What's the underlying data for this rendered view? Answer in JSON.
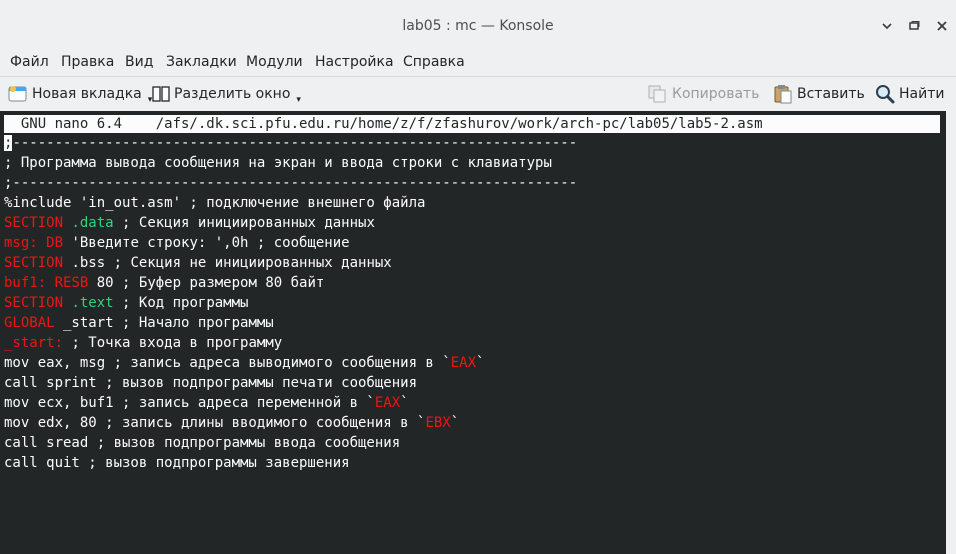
{
  "window": {
    "title": "lab05 : mc — Konsole",
    "minimize_icon": "chevron-down-icon",
    "maximize_icon": "restore-icon",
    "close_icon": "close-icon"
  },
  "menu": [
    "Файл",
    "Правка",
    "Вид",
    "Закладки",
    "Модули",
    "Настройка",
    "Справка"
  ],
  "toolbar": {
    "new_tab": "Новая вкладка",
    "split": "Разделить окно",
    "copy": "Копировать",
    "paste": "Вставить",
    "find": "Найти"
  },
  "nano": {
    "header": "  GNU nano 6.4    /afs/.dk.sci.pfu.edu.ru/home/z/f/zfashurov/work/arch-pc/lab05/lab5-2.asm"
  },
  "colors": {
    "keyword": "#ed1515",
    "section_name": "#2bd57c",
    "text": "#fcfcfc",
    "background": "#232627"
  },
  "code_lines": [
    [
      {
        "t": ";",
        "c": "cursor"
      },
      {
        "t": "-------------------------------------------------------------------",
        "c": "dim"
      }
    ],
    [
      {
        "t": "; Программа вывода сообщения на экран и ввода строки с клавиатуры",
        "c": "dim"
      }
    ],
    [
      {
        "t": ";-------------------------------------------------------------------",
        "c": "dim"
      }
    ],
    [
      {
        "t": "%include 'in_out.asm' ; подключение внешнего файла",
        "c": "dim"
      }
    ],
    [
      {
        "t": "SECTION",
        "c": "red"
      },
      {
        "t": " ",
        "c": "dim"
      },
      {
        "t": ".data",
        "c": "green"
      },
      {
        "t": " ; Секция инициированных данных",
        "c": "dim"
      }
    ],
    [
      {
        "t": "msg:",
        "c": "red"
      },
      {
        "t": " ",
        "c": "dim"
      },
      {
        "t": "DB",
        "c": "red"
      },
      {
        "t": " 'Введите строку: ',0h ; сообщение",
        "c": "dim"
      }
    ],
    [
      {
        "t": "SECTION",
        "c": "red"
      },
      {
        "t": " .bss ; Секция не инициированных данных",
        "c": "dim"
      }
    ],
    [
      {
        "t": "buf1:",
        "c": "red"
      },
      {
        "t": " ",
        "c": "dim"
      },
      {
        "t": "RESB",
        "c": "red"
      },
      {
        "t": " 80 ; Буфер размером 80 байт",
        "c": "dim"
      }
    ],
    [
      {
        "t": "SECTION",
        "c": "red"
      },
      {
        "t": " ",
        "c": "dim"
      },
      {
        "t": ".text",
        "c": "green"
      },
      {
        "t": " ; Код программы",
        "c": "dim"
      }
    ],
    [
      {
        "t": "GLOBAL",
        "c": "red"
      },
      {
        "t": " _start ; Начало программы",
        "c": "dim"
      }
    ],
    [
      {
        "t": "_start:",
        "c": "red"
      },
      {
        "t": " ; Точка входа в программу",
        "c": "dim"
      }
    ],
    [
      {
        "t": "mov eax, msg ; запись адреса выводимого сообщения в `",
        "c": "dim"
      },
      {
        "t": "EAX",
        "c": "red"
      },
      {
        "t": "`",
        "c": "dim"
      }
    ],
    [
      {
        "t": "call sprint ; вызов подпрограммы печати сообщения",
        "c": "dim"
      }
    ],
    [
      {
        "t": "mov ecx, buf1 ; запись адреса переменной в `",
        "c": "dim"
      },
      {
        "t": "EAX",
        "c": "red"
      },
      {
        "t": "`",
        "c": "dim"
      }
    ],
    [
      {
        "t": "mov edx, 80 ; запись длины вводимого сообщения в `",
        "c": "dim"
      },
      {
        "t": "EBX",
        "c": "red"
      },
      {
        "t": "`",
        "c": "dim"
      }
    ],
    [
      {
        "t": "call sread ; вызов подпрограммы ввода сообщения",
        "c": "dim"
      }
    ],
    [
      {
        "t": "call quit ; вызов подпрограммы завершения",
        "c": "dim"
      }
    ]
  ]
}
